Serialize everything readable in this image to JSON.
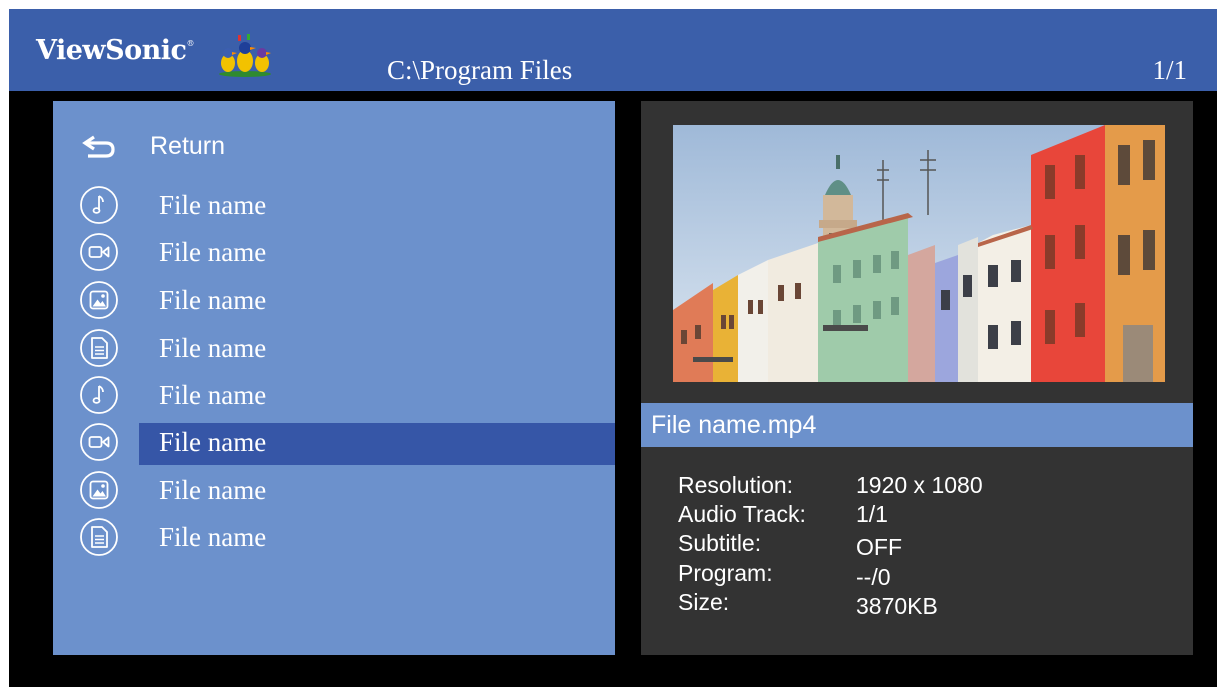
{
  "header": {
    "brand": "ViewSonic",
    "brand_mark": "®",
    "path": "C:\\Program Files",
    "page": "1/1"
  },
  "list": {
    "return_label": "Return",
    "items": [
      {
        "icon": "music-icon",
        "label": "File name"
      },
      {
        "icon": "video-icon",
        "label": "File name"
      },
      {
        "icon": "image-icon",
        "label": "File name"
      },
      {
        "icon": "document-icon",
        "label": "File name"
      },
      {
        "icon": "music-icon",
        "label": "File name"
      },
      {
        "icon": "video-icon",
        "label": "File name",
        "selected": true
      },
      {
        "icon": "image-icon",
        "label": "File name"
      },
      {
        "icon": "document-icon",
        "label": "File name"
      }
    ]
  },
  "info": {
    "title": "File name.mp4",
    "details": [
      {
        "label": "Resolution:",
        "value": "1920 x 1080"
      },
      {
        "label": "Audio Track:",
        "value": "1/1"
      },
      {
        "label": "Subtitle:",
        "value": "OFF"
      },
      {
        "label": "Program:",
        "value": "--/0"
      },
      {
        "label": "Size:",
        "value": "3870KB"
      }
    ]
  },
  "colors": {
    "header_bg": "#3b5faa",
    "list_bg": "#6c91cc",
    "selected_bg": "#3656a7",
    "info_bg": "#333333"
  }
}
